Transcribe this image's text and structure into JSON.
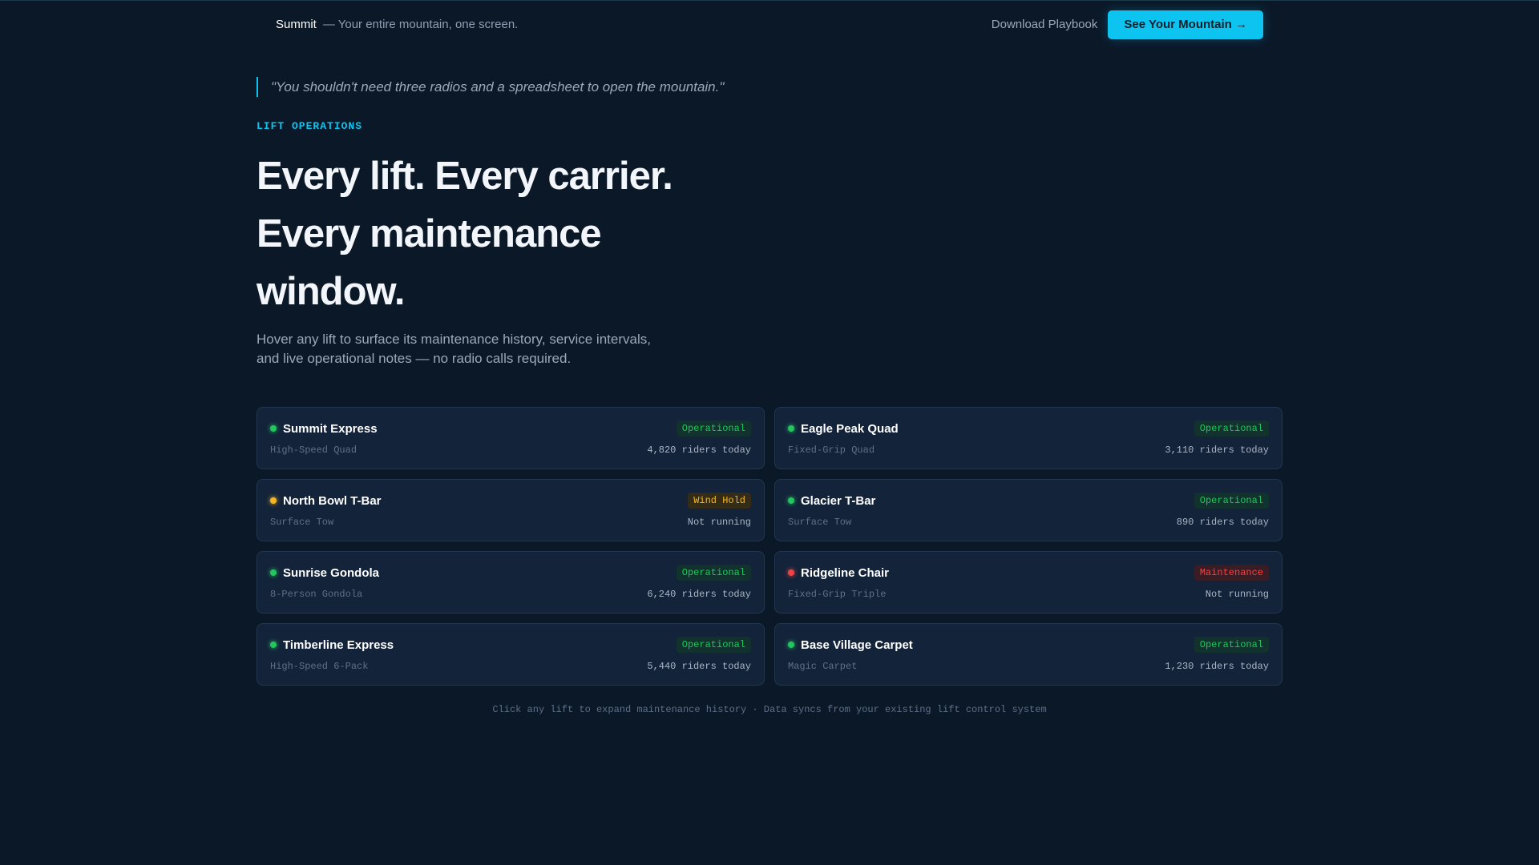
{
  "header": {
    "brand": "Summit",
    "tagline": "— Your entire mountain, one screen.",
    "download_label": "Download Playbook",
    "cta_label": "See Your Mountain →"
  },
  "hero": {
    "quote": "\"You shouldn't need three radios and a spreadsheet to open the mountain.\"",
    "eyebrow": "LIFT OPERATIONS",
    "headline": "Every lift. Every carrier. Every maintenance window.",
    "subhead": "Hover any lift to surface its maintenance history, service intervals, and live operational notes — no radio calls required."
  },
  "status_colors": {
    "operational": "#22c55e",
    "wind_hold": "#f5b71f",
    "maintenance": "#ef4444"
  },
  "lifts": [
    {
      "name": "Summit Express",
      "type": "High-Speed Quad",
      "status": "Operational",
      "status_key": "operational",
      "riders": "4,820 riders today"
    },
    {
      "name": "Eagle Peak Quad",
      "type": "Fixed-Grip Quad",
      "status": "Operational",
      "status_key": "operational",
      "riders": "3,110 riders today"
    },
    {
      "name": "North Bowl T-Bar",
      "type": "Surface Tow",
      "status": "Wind Hold",
      "status_key": "wind_hold",
      "riders": "Not running"
    },
    {
      "name": "Glacier T-Bar",
      "type": "Surface Tow",
      "status": "Operational",
      "status_key": "operational",
      "riders": "890 riders today"
    },
    {
      "name": "Sunrise Gondola",
      "type": "8-Person Gondola",
      "status": "Operational",
      "status_key": "operational",
      "riders": "6,240 riders today"
    },
    {
      "name": "Ridgeline Chair",
      "type": "Fixed-Grip Triple",
      "status": "Maintenance",
      "status_key": "maintenance",
      "riders": "Not running"
    },
    {
      "name": "Timberline Express",
      "type": "High-Speed 6-Pack",
      "status": "Operational",
      "status_key": "operational",
      "riders": "5,440 riders today"
    },
    {
      "name": "Base Village Carpet",
      "type": "Magic Carpet",
      "status": "Operational",
      "status_key": "operational",
      "riders": "1,230 riders today"
    }
  ],
  "footnote": "Click any lift to expand maintenance history · Data syncs from your existing lift control system"
}
